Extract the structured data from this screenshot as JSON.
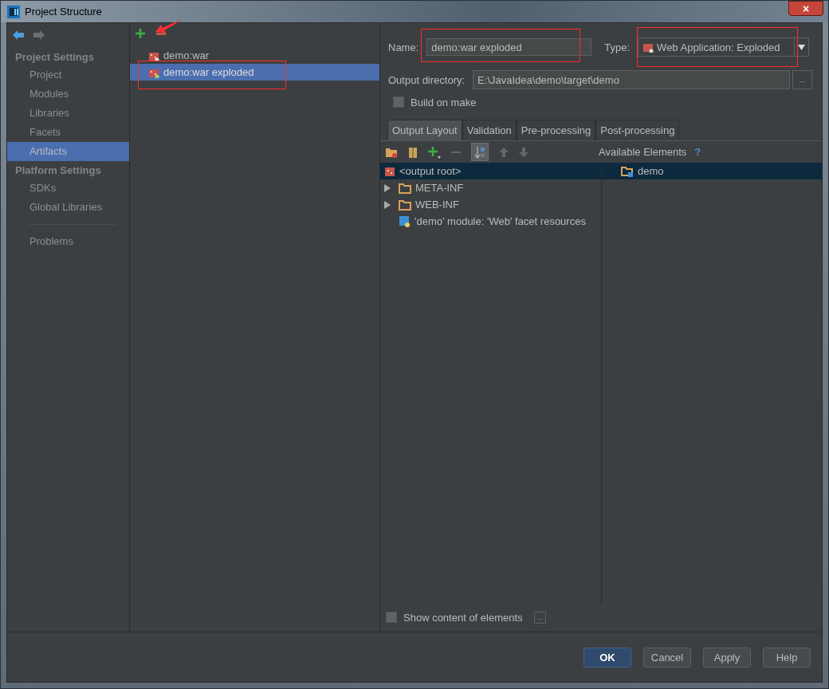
{
  "window": {
    "title": "Project Structure",
    "close": "×"
  },
  "sidebar": {
    "sections": [
      {
        "heading": "Project Settings",
        "items": [
          {
            "label": "Project",
            "selected": false
          },
          {
            "label": "Modules",
            "selected": false
          },
          {
            "label": "Libraries",
            "selected": false
          },
          {
            "label": "Facets",
            "selected": false
          },
          {
            "label": "Artifacts",
            "selected": true
          }
        ]
      },
      {
        "heading": "Platform Settings",
        "items": [
          {
            "label": "SDKs",
            "selected": false
          },
          {
            "label": "Global Libraries",
            "selected": false
          }
        ]
      }
    ],
    "extra_items": [
      {
        "label": "Problems",
        "selected": false
      }
    ]
  },
  "artifacts": [
    {
      "label": "demo:war",
      "selected": false
    },
    {
      "label": "demo:war exploded",
      "selected": true
    }
  ],
  "form": {
    "name_label": "Name:",
    "name": "demo:war exploded",
    "type_label": "Type:",
    "type": "Web Application: Exploded",
    "output_label": "Output directory:",
    "output": "E:\\JavaIdea\\demo\\target\\demo",
    "browse": "...",
    "build_on_make": {
      "label": "Build on make",
      "checked": false
    }
  },
  "tabs": [
    {
      "label": "Output Layout",
      "selected": true
    },
    {
      "label": "Validation",
      "selected": false
    },
    {
      "label": "Pre-processing",
      "selected": false
    },
    {
      "label": "Post-processing",
      "selected": false
    }
  ],
  "layout": {
    "available_label": "Available Elements",
    "help": "?",
    "tree": [
      {
        "label": "<output root>",
        "kind": "root",
        "selected": true,
        "children": [
          {
            "label": "META-INF",
            "kind": "folder",
            "selected": false,
            "expanded": false
          },
          {
            "label": "WEB-INF",
            "kind": "folder",
            "selected": false,
            "expanded": false
          },
          {
            "label": "'demo' module: 'Web' facet resources",
            "kind": "facet",
            "selected": false
          }
        ]
      }
    ],
    "available": [
      {
        "label": "demo",
        "selected": true
      }
    ],
    "show_content": {
      "label": "Show content of elements",
      "checked": false
    },
    "more": "..."
  },
  "buttons": [
    {
      "label": "OK",
      "kind": "default"
    },
    {
      "label": "Cancel",
      "kind": "normal"
    },
    {
      "label": "Apply",
      "kind": "normal"
    },
    {
      "label": "Help",
      "kind": "normal"
    }
  ]
}
